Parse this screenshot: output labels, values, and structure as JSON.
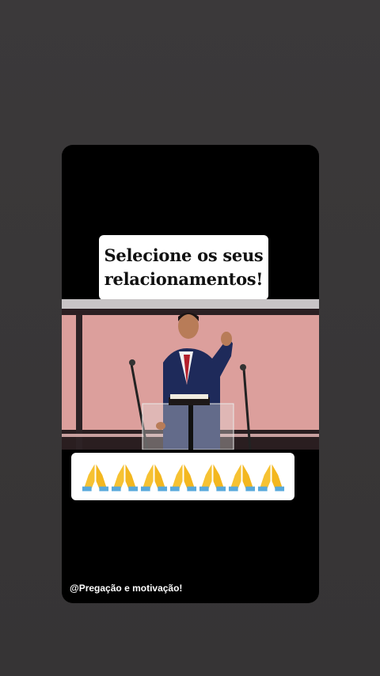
{
  "story": {
    "caption_line1": "Selecione os seus",
    "caption_line2": "relacionamentos!",
    "emoji_row": [
      "praying-hands",
      "praying-hands",
      "praying-hands",
      "praying-hands",
      "praying-hands",
      "praying-hands",
      "praying-hands"
    ],
    "handle": "@Pregação e motivação!"
  }
}
